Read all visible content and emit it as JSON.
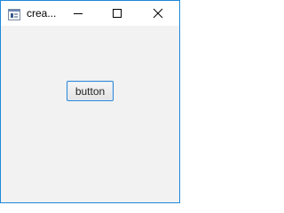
{
  "window": {
    "title": "crea...",
    "icon": "java-app-icon",
    "controls": {
      "minimize": "minimize-icon",
      "maximize": "maximize-icon",
      "close": "close-icon"
    },
    "border_color": "#1e88d8"
  },
  "content": {
    "button_label": "button",
    "background": "#f2f2f2"
  }
}
